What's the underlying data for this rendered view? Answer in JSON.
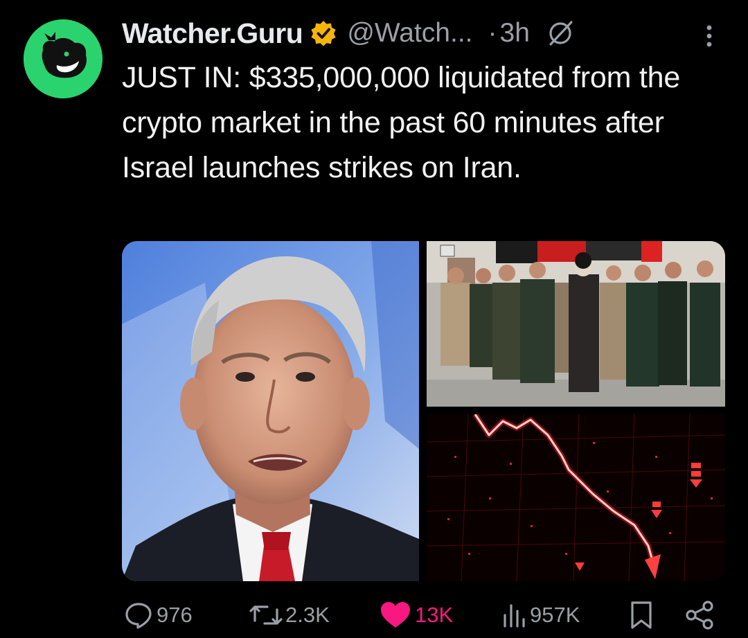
{
  "account": {
    "display_name": "Watcher.Guru",
    "handle": "@Watch...",
    "separator": "·",
    "time": "3h",
    "avatar_icon": "whale-logo-icon",
    "verified_icon": "gold-verified-badge-icon",
    "grok_icon": "grok-slash-icon",
    "more_icon": "more-vertical-icon"
  },
  "tweet": {
    "text": "JUST IN: $335,000,000 liquidated from the crypto market in the past 60 minutes after Israel launches strikes on Iran."
  },
  "media": [
    {
      "name": "netanyahu-portrait-photo"
    },
    {
      "name": "iranian-military-leaders-photo"
    },
    {
      "name": "red-crashing-chart-graphic"
    }
  ],
  "actions": {
    "replies": "976",
    "reposts": "2.3K",
    "likes": "13K",
    "views": "957K"
  },
  "colors": {
    "background": "#000000",
    "text": "#e7e9ea",
    "muted": "#9aa0a6",
    "like_accent": "#f91880",
    "avatar_green": "#2bd36f",
    "verified_gold": "#f5b50a"
  }
}
